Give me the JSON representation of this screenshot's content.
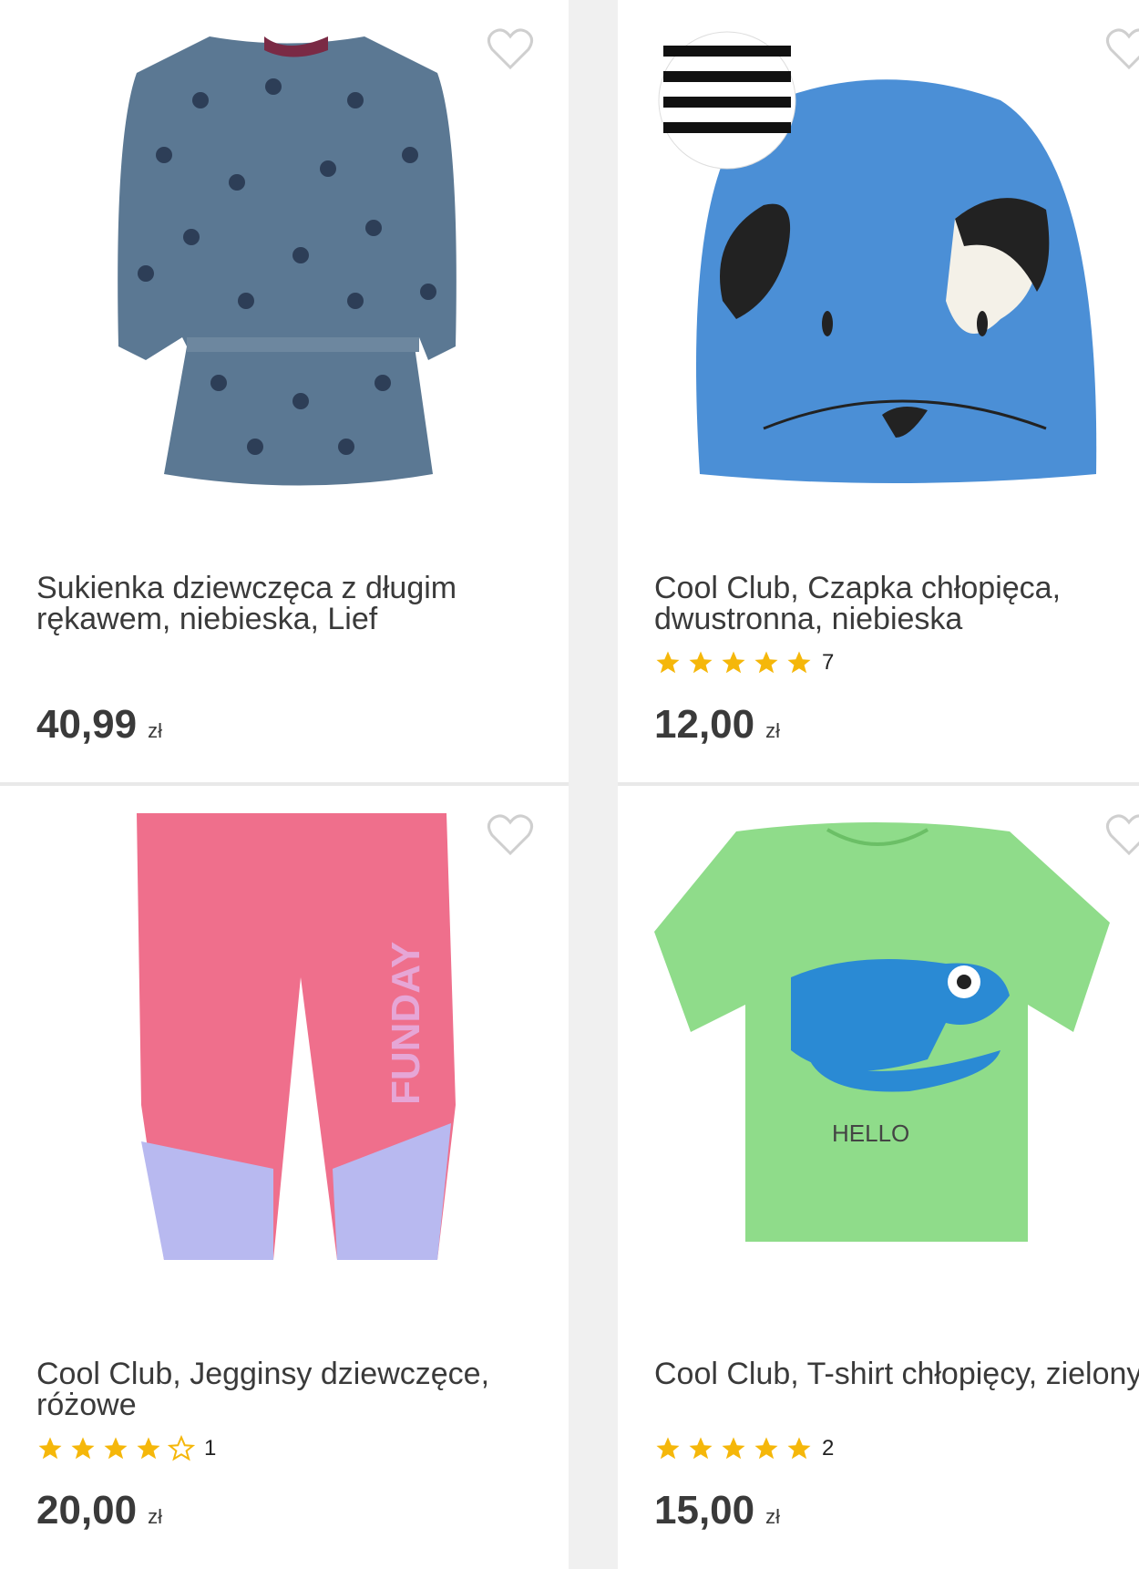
{
  "products": [
    {
      "title": "Sukienka dziewczęca z długim rękawem, niebieska, Lief",
      "price": "40,99",
      "currency": "zł",
      "image_icon": "star-print-dress-image"
    },
    {
      "title": "Cool Club, Czapka chłopięca, dwustronna, niebieska",
      "rating": 5,
      "review_count": "7",
      "price": "12,00",
      "currency": "zł",
      "image_icon": "dog-face-hat-image"
    },
    {
      "title": "Cool Club, Jegginsy dziewczęce, różowe",
      "rating": 4,
      "review_count": "1",
      "price": "20,00",
      "currency": "zł",
      "image_icon": "pink-leggings-image"
    },
    {
      "title": "Cool Club, T-shirt chłopięcy, zielony",
      "rating": 5,
      "review_count": "2",
      "price": "15,00",
      "currency": "zł",
      "image_icon": "green-tshirt-image"
    }
  ],
  "colors": {
    "star": "#f5b70a",
    "price_text": "#3a3a3a",
    "heart_outline": "#cfcfcf"
  }
}
